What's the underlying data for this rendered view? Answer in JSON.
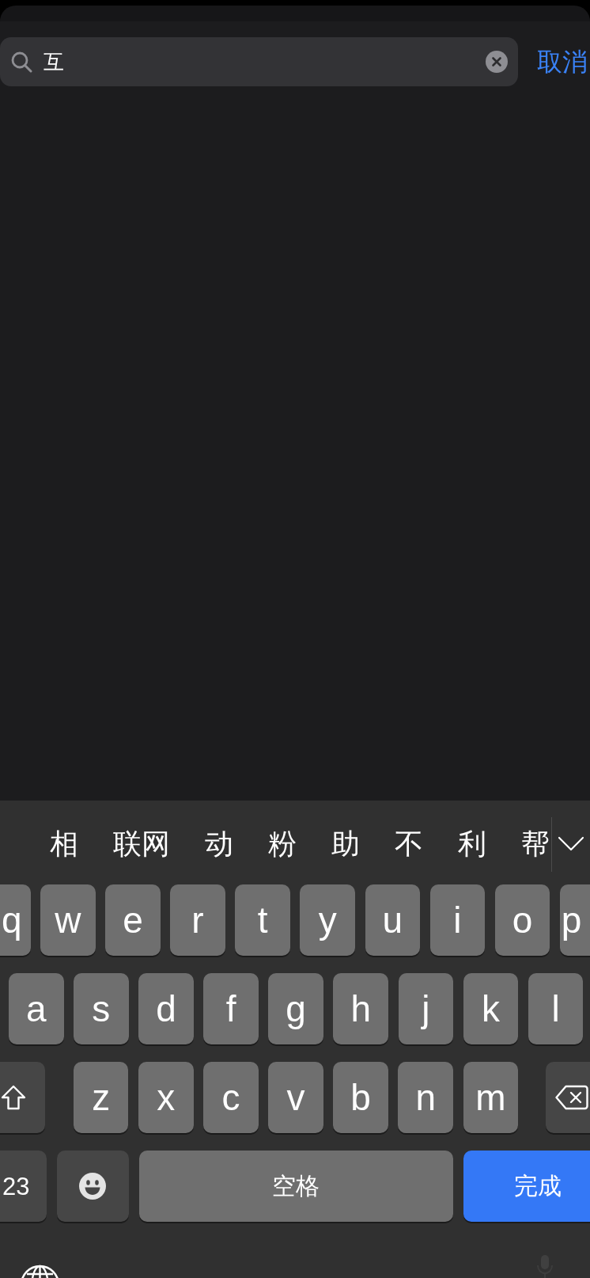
{
  "search": {
    "value": "互",
    "cancel": "取消"
  },
  "candidates": [
    "相",
    "联网",
    "动",
    "粉",
    "助",
    "不",
    "利",
    "帮"
  ],
  "keyboard": {
    "key_rows": [
      {
        "keys": [
          {
            "kind": "letter",
            "label": "q"
          },
          {
            "kind": "letter",
            "label": "w"
          },
          {
            "kind": "letter",
            "label": "e"
          },
          {
            "kind": "letter",
            "label": "r"
          },
          {
            "kind": "letter",
            "label": "t"
          },
          {
            "kind": "letter",
            "label": "y"
          },
          {
            "kind": "letter",
            "label": "u"
          },
          {
            "kind": "letter",
            "label": "i"
          },
          {
            "kind": "letter",
            "label": "o"
          },
          {
            "kind": "letter",
            "label": "p"
          }
        ]
      },
      {
        "keys": [
          {
            "kind": "letter",
            "label": "a"
          },
          {
            "kind": "letter",
            "label": "s"
          },
          {
            "kind": "letter",
            "label": "d"
          },
          {
            "kind": "letter",
            "label": "f"
          },
          {
            "kind": "letter",
            "label": "g"
          },
          {
            "kind": "letter",
            "label": "h"
          },
          {
            "kind": "letter",
            "label": "j"
          },
          {
            "kind": "letter",
            "label": "k"
          },
          {
            "kind": "letter",
            "label": "l"
          }
        ]
      },
      {
        "keys": [
          {
            "kind": "shift"
          },
          {
            "kind": "letter",
            "label": "z"
          },
          {
            "kind": "letter",
            "label": "x"
          },
          {
            "kind": "letter",
            "label": "c"
          },
          {
            "kind": "letter",
            "label": "v"
          },
          {
            "kind": "letter",
            "label": "b"
          },
          {
            "kind": "letter",
            "label": "n"
          },
          {
            "kind": "letter",
            "label": "m"
          },
          {
            "kind": "backspace"
          }
        ]
      },
      {
        "keys": [
          {
            "kind": "numbers",
            "label": "23"
          },
          {
            "kind": "emoji"
          },
          {
            "kind": "space",
            "label": "空格"
          },
          {
            "kind": "return",
            "label": "完成"
          }
        ]
      }
    ]
  }
}
